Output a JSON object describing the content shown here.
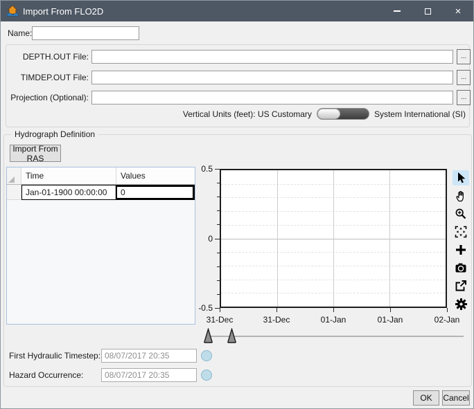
{
  "window": {
    "title": "Import From FLO2D",
    "icon": "flood-house-icon",
    "close_glyph": "×"
  },
  "name_field": {
    "label": "Name:",
    "value": ""
  },
  "files": {
    "depth": {
      "label": "DEPTH.OUT File:",
      "value": "",
      "browse": "..."
    },
    "timdep": {
      "label": "TIMDEP.OUT File:",
      "value": "",
      "browse": "..."
    },
    "projection": {
      "label": "Projection (Optional):",
      "value": "",
      "browse": "..."
    }
  },
  "units": {
    "prefix": "Vertical Units (feet):",
    "left_option": "US Customary",
    "right_option": "System International (SI)",
    "selected": "US Customary"
  },
  "hydrograph": {
    "group_label": "Hydrograph Definition",
    "import_button": "Import From RAS",
    "table": {
      "columns": [
        "Time",
        "Values"
      ],
      "rows": [
        [
          "Jan-01-1900 00:00:00",
          "0"
        ]
      ]
    },
    "first_timestep": {
      "label": "First Hydraulic Timestep:",
      "value": "08/07/2017 20:35"
    },
    "hazard": {
      "label": "Hazard Occurrence:",
      "value": "08/07/2017 20:35"
    }
  },
  "chart_data": {
    "type": "line",
    "title": "",
    "xlabel": "",
    "ylabel": "",
    "x_tick_labels": [
      "31-Dec",
      "31-Dec",
      "01-Jan",
      "01-Jan",
      "02-Jan"
    ],
    "y_tick_labels": [
      "0.5",
      "0",
      "-0.5"
    ],
    "ylim": [
      -0.5,
      0.5
    ],
    "y_minor_step": 0.1,
    "grid": "on",
    "series": []
  },
  "chart_toolbar": {
    "selected_tool": "cursor",
    "tools": [
      "cursor",
      "pan-hand",
      "zoom-in",
      "fit-extents",
      "add-point",
      "snapshot",
      "export",
      "settings"
    ]
  },
  "time_slider": {
    "handle_positions": [
      299,
      333
    ]
  },
  "footer": {
    "ok": "OK",
    "cancel": "Cancel"
  }
}
